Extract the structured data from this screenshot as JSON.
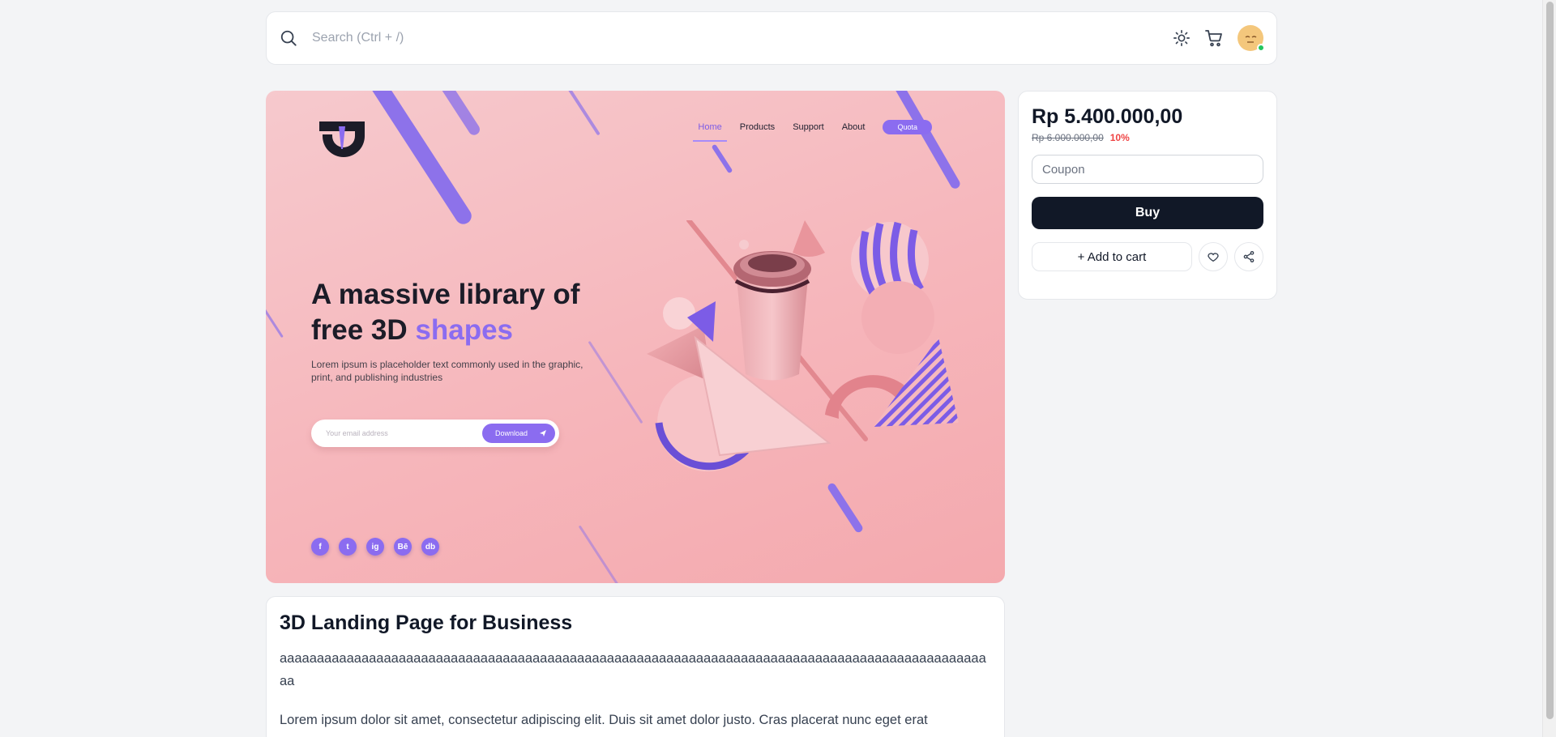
{
  "search": {
    "placeholder": "Search (Ctrl + /)"
  },
  "header_icons": [
    "search-icon",
    "sun-icon",
    "cart-icon",
    "avatar"
  ],
  "hero": {
    "nav": {
      "home": "Home",
      "products": "Products",
      "support": "Support",
      "about": "About",
      "quote": "Quota"
    },
    "headline_line1": "A massive library of",
    "headline_line2_prefix": "free 3D ",
    "headline_accent": "shapes",
    "subtext": "Lorem ipsum is placeholder text commonly used in the graphic, print, and publishing industries",
    "email_placeholder": "Your email address",
    "download_label": "Download",
    "socials": [
      "f",
      "t",
      "ig",
      "Bē",
      "db"
    ],
    "accent_color": "#8b6cf0"
  },
  "product": {
    "price": "Rp 5.400.000,00",
    "old_price": "Rp 6.000.000,00",
    "discount": "10%",
    "coupon_placeholder": "Coupon",
    "buy_label": "Buy",
    "add_to_cart_label": "+ Add to cart"
  },
  "description": {
    "title": "3D Landing Page for Business",
    "text": "aaaaaaaaaaaaaaaaaaaaaaaaaaaaaaaaaaaaaaaaaaaaaaaaaaaaaaaaaaaaaaaaaaaaaaaaaaaaaaaaaaaaaaaaaaaaaaaaa",
    "lorem": "Lorem ipsum dolor sit amet, consectetur adipiscing elit. Duis sit amet dolor justo. Cras placerat nunc eget erat"
  },
  "colors": {
    "primary": "#111827",
    "discount": "#ef4444",
    "online": "#22c55e"
  }
}
